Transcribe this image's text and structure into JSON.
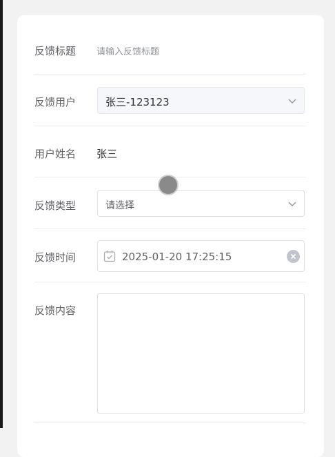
{
  "form": {
    "title": {
      "label": "反馈标题",
      "placeholder": "请输入反馈标题"
    },
    "user": {
      "label": "反馈用户",
      "value": "张三-123123"
    },
    "name": {
      "label": "用户姓名",
      "value": "张三"
    },
    "type": {
      "label": "反馈类型",
      "placeholder": "请选择"
    },
    "time": {
      "label": "反馈时间",
      "value": "2025-01-20 17:25:15"
    },
    "content": {
      "label": "反馈内容",
      "value": ""
    }
  },
  "icons": {
    "chevron": "chevron-down-icon",
    "calendar": "calendar-icon",
    "clear": "clear-circle-icon"
  },
  "colors": {
    "label": "#606266",
    "text": "#303133",
    "border": "#dcdfe6",
    "filled_bg": "#f5f7fa"
  }
}
